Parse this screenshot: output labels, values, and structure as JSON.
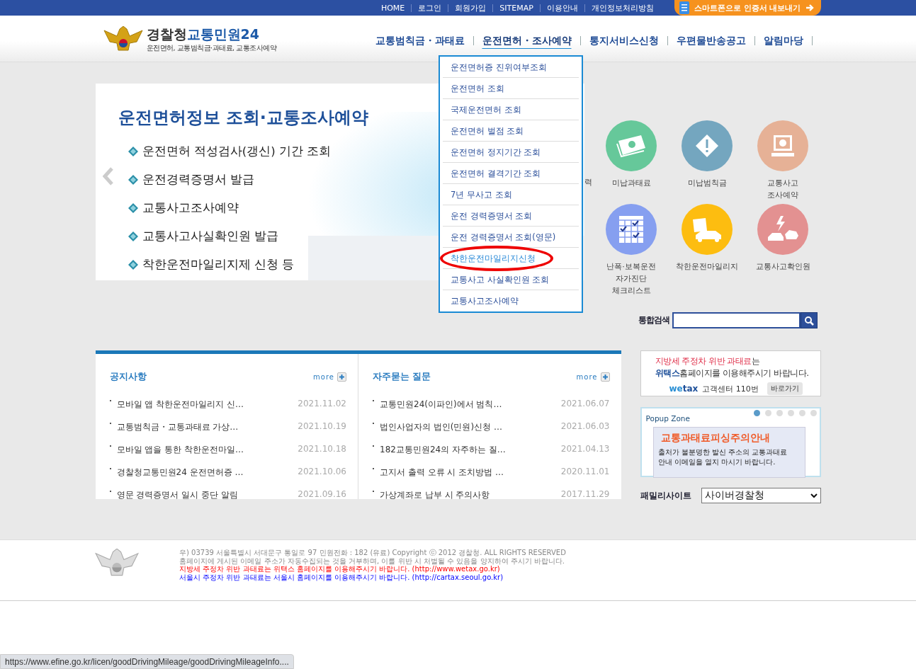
{
  "top_links": [
    "HOME",
    "로그인",
    "회원가입",
    "SITEMAP",
    "이용안내",
    "개인정보처리방침"
  ],
  "app_button": "스마트폰으로 인증서 내보내기",
  "logo": {
    "title_a": "경찰청",
    "title_b": "교통민원24",
    "subtitle": "운전면허, 교통범칙금·과태료, 교통조사예약"
  },
  "nav": [
    {
      "label": "교통범칙금・과태료",
      "expanded": false
    },
    {
      "label": "운전면허・조사예약",
      "expanded": true
    },
    {
      "label": "통지서비스신청",
      "expanded": false
    },
    {
      "label": "우편물반송공고",
      "expanded": false
    },
    {
      "label": "알림마당",
      "expanded": false
    }
  ],
  "dropdown": [
    {
      "label": "운전면허증 진위여부조회",
      "selected": false
    },
    {
      "label": "운전면허 조회",
      "selected": false
    },
    {
      "label": "국제운전면허 조회",
      "selected": false
    },
    {
      "label": "운전면허 벌점 조회",
      "selected": false
    },
    {
      "label": "운전면허 정지기간 조회",
      "selected": false
    },
    {
      "label": "운전면허 결격기간 조회",
      "selected": false
    },
    {
      "label": "7년 무사고 조회",
      "selected": false
    },
    {
      "label": "운전 경력증명서 조회",
      "selected": false
    },
    {
      "label": "운전 경력증명서 조회(영문)",
      "selected": false
    },
    {
      "label": "착한운전마일리지신청",
      "selected": true
    },
    {
      "label": "교통사고 사실확인원 조회",
      "selected": false
    },
    {
      "label": "교통사고조사예약",
      "selected": false
    }
  ],
  "banner": {
    "title": "운전면허정보 조회·교통조사예약",
    "items": [
      "운전면허 적성검사(갱신) 기간 조회",
      "운전경력증명서 발급",
      "교통사고조사예약",
      "교통사고사실확인원 발급",
      "착한운전마일리지제 신청 등"
    ],
    "hidden_label": "력"
  },
  "quick_links": [
    {
      "label": "미납과태료",
      "kind": "money",
      "color": "#66c89a"
    },
    {
      "label": "미납범칙금",
      "kind": "warning",
      "color": "#74a6bf"
    },
    {
      "label": "교통사고\n조사예약",
      "kind": "computer",
      "color": "#e6b196"
    },
    {
      "label": "난폭·보복운전\n자가진단\n체크리스트",
      "kind": "calendar",
      "color": "#869ff0"
    },
    {
      "label": "착한운전마일리지",
      "kind": "car",
      "color": "#fdbd10"
    },
    {
      "label": "교통사고확인원",
      "kind": "crash",
      "color": "#e39191"
    }
  ],
  "search": {
    "label": "통합검색"
  },
  "boards": [
    {
      "title": "공지사항",
      "more": "more",
      "rows": [
        {
          "title": "모바일 앱 착한운전마일리지 신…",
          "date": "2021.11.02"
        },
        {
          "title": "교통범칙금・교통과태료 가상…",
          "date": "2021.10.19"
        },
        {
          "title": "모바일 앱을 통한 착한운전마일…",
          "date": "2021.10.18"
        },
        {
          "title": "경찰청교통민원24 운전면허증 …",
          "date": "2021.10.06"
        },
        {
          "title": "영문 경력증명서 일시 중단 알림",
          "date": "2021.09.16"
        }
      ]
    },
    {
      "title": "자주묻는 질문",
      "more": "more",
      "rows": [
        {
          "title": "교통민원24(이파인)에서 범칙…",
          "date": "2021.06.07"
        },
        {
          "title": "법인사업자의 법인(민원)신청 …",
          "date": "2021.06.03"
        },
        {
          "title": "182교통민원24의 자주하는 질…",
          "date": "2021.04.13"
        },
        {
          "title": "고지서 출력 오류 시 조치방법 …",
          "date": "2020.11.01"
        },
        {
          "title": "가상계좌로 납부 시 주의사항",
          "date": "2017.11.29"
        }
      ]
    }
  ],
  "wetax": {
    "line1_highlight": "지방세 주정차 위반 과태료",
    "line1_rest": "는",
    "line2_highlight": "위택스",
    "line2_rest": "홈페이지를 이용해주시기 바랍니다.",
    "brand_a": "we",
    "brand_b": "tax",
    "center": "고객센터 110번",
    "button": "바로가기"
  },
  "popup": {
    "label": "Popup Zone",
    "dots": [
      {
        "selected": true
      },
      {
        "selected": false
      },
      {
        "selected": false
      },
      {
        "selected": false
      },
      {
        "selected": false
      },
      {
        "selected": false
      }
    ],
    "title": "교통과태료피싱주의안내",
    "body": "출처가 불분명한 발신 주소의 교통과태료\n안내 이메일을 열지 마시기 바랍니다."
  },
  "family": {
    "label": "패밀리사이트",
    "value": "사이버경찰청"
  },
  "footer": [
    {
      "kind": "plain",
      "text": "우) 03739 서울특별시 서대문구 통일로 97  민원전화 : 182 (유료)     Copyright ⓒ 2012 경찰청. ALL RIGHTS RESERVED"
    },
    {
      "kind": "plain",
      "text": "홈페이지에 게시된 이메일 주소가 자동수집되는 것을 거부하며, 이를 위반 시 처벌될 수 있음을 양지하여 주시기 바랍니다."
    },
    {
      "kind": "red",
      "text": "지방세 주정차 위반 과태료는 위택스 홈페이지를 이용해주시기 바랍니다. (http://www.wetax.go.kr)"
    },
    {
      "kind": "blue",
      "text": "서울시 주정차 위반 과태료는 서울시 홈페이지를 이용해주시기 바랍니다. (http://cartax.seoul.go.kr)"
    }
  ],
  "status_url": "https://www.efine.go.kr/licen/goodDrivingMileage/goodDrivingMileageInfo...."
}
